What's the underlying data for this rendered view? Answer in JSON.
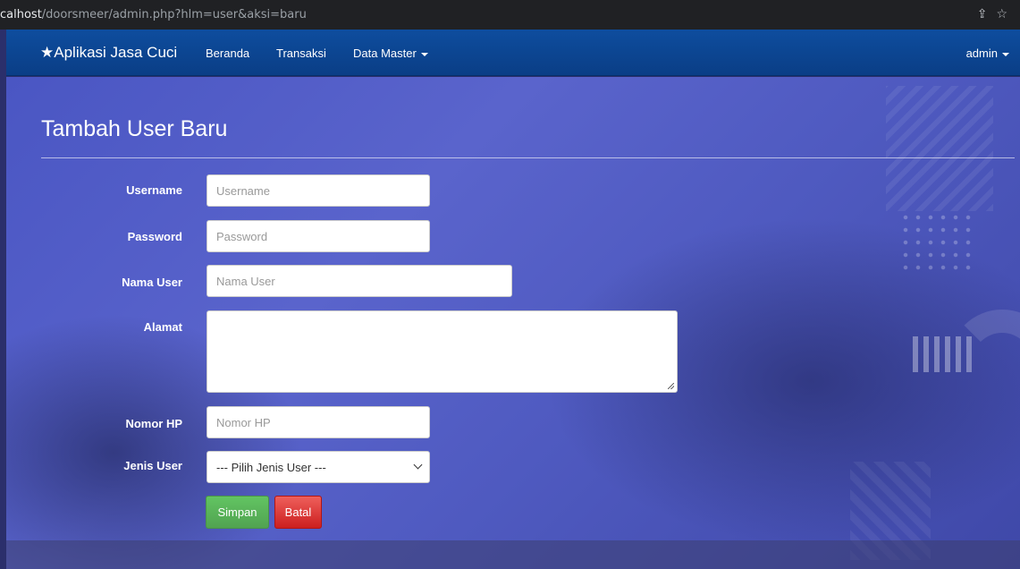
{
  "browser": {
    "url_host": "calhost",
    "url_path": "/doorsmeer/admin.php?hlm=user&aksi=baru",
    "share_icon": "share-icon",
    "star_icon": "bookmark-star-icon"
  },
  "navbar": {
    "brand": "Aplikasi Jasa Cuci",
    "brand_icon": "star-icon",
    "items": [
      {
        "label": "Beranda"
      },
      {
        "label": "Transaksi"
      },
      {
        "label": "Data Master"
      }
    ],
    "user": "admin",
    "bg_color": "#0e4d9e"
  },
  "page": {
    "title": "Tambah User Baru"
  },
  "form": {
    "username": {
      "label": "Username",
      "placeholder": "Username",
      "value": ""
    },
    "password": {
      "label": "Password",
      "placeholder": "Password",
      "value": ""
    },
    "nama_user": {
      "label": "Nama User",
      "placeholder": "Nama User",
      "value": ""
    },
    "alamat": {
      "label": "Alamat",
      "value": ""
    },
    "nomor_hp": {
      "label": "Nomor HP",
      "placeholder": "Nomor HP",
      "value": ""
    },
    "jenis_user": {
      "label": "Jenis User",
      "selected": "--- Pilih Jenis User ---"
    },
    "save_label": "Simpan",
    "cancel_label": "Batal",
    "save_color": "#5cb85c",
    "cancel_color": "#d9302c"
  }
}
